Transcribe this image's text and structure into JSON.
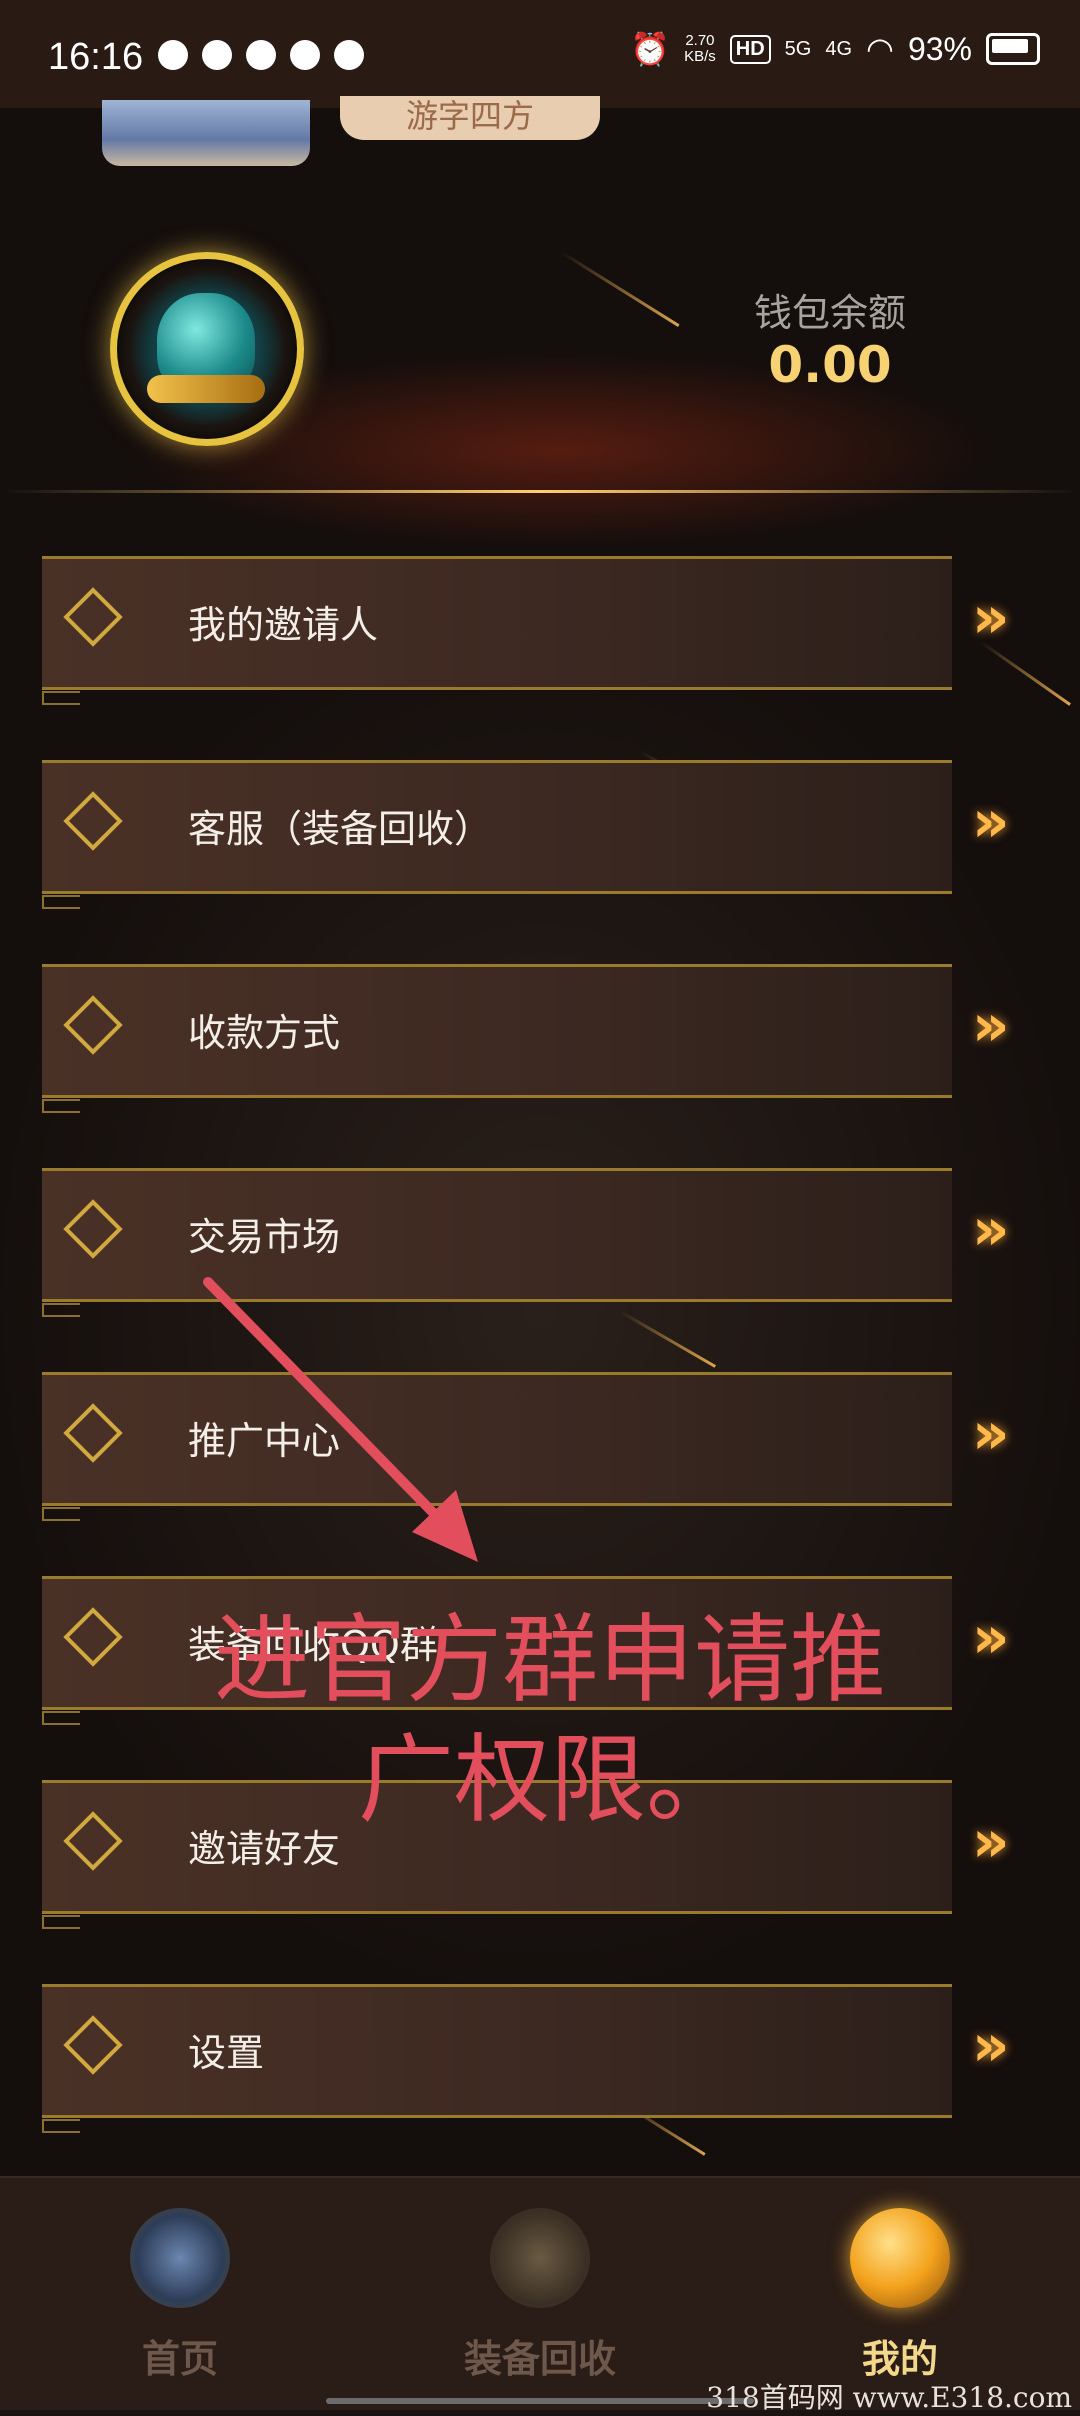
{
  "status_bar": {
    "time": "16:16",
    "speed_value": "2.70",
    "speed_unit": "KB/s",
    "hd_tag": "HD",
    "net_5g": "5G",
    "net_4g": "4G",
    "battery_percent": "93%"
  },
  "profile": {
    "nickname": "游字四方"
  },
  "wallet": {
    "label": "钱包余额",
    "balance": "0.00"
  },
  "menu": {
    "items": [
      {
        "label": "我的邀请人"
      },
      {
        "label": "客服（装备回收）"
      },
      {
        "label": "收款方式"
      },
      {
        "label": "交易市场"
      },
      {
        "label": "推广中心"
      },
      {
        "label": "装备回收QQ群"
      },
      {
        "label": "邀请好友"
      },
      {
        "label": "设置"
      }
    ]
  },
  "annotation": {
    "line1": "进官方群申请推",
    "line2": "广权限。"
  },
  "tabbar": {
    "tabs": [
      {
        "label": "首页",
        "icon": "fist-emblem-icon",
        "active": false
      },
      {
        "label": "装备回收",
        "icon": "treasure-pile-icon",
        "active": false
      },
      {
        "label": "我的",
        "icon": "golden-orb-icon",
        "active": true
      }
    ]
  },
  "watermark": "318首码网 www.E318.com",
  "colors": {
    "accent_gold": "#f7d272",
    "annotation_red": "#e24e5c",
    "chevron_orange": "#ffb94a"
  }
}
